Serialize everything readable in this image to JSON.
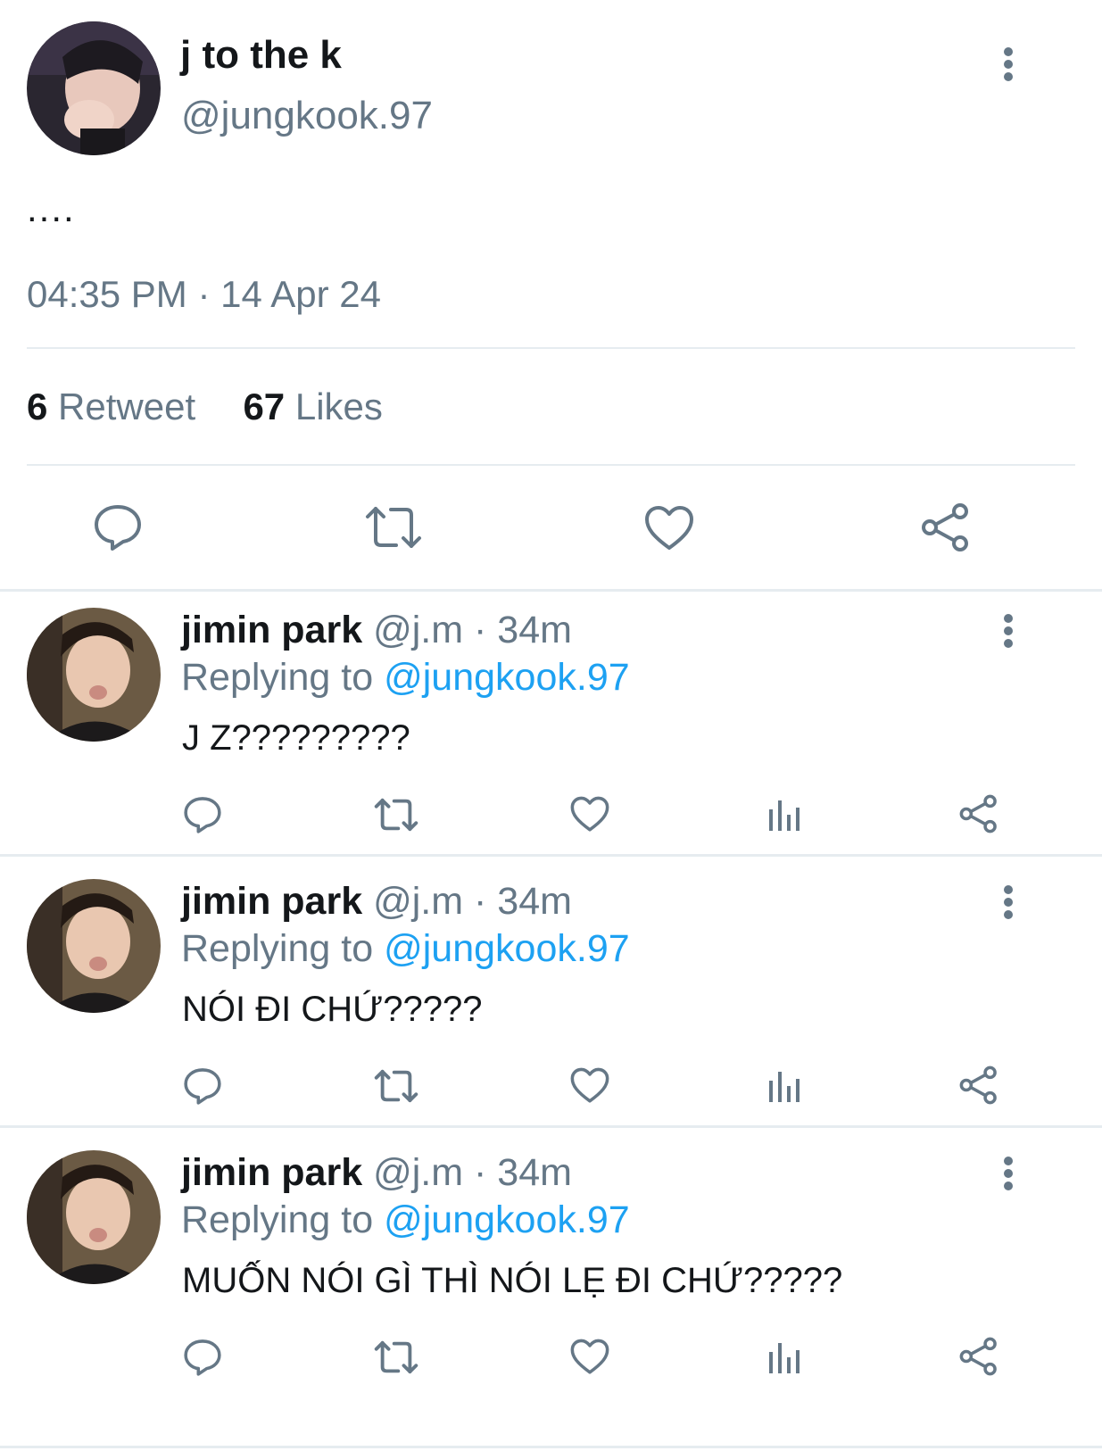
{
  "main_tweet": {
    "display_name": "j to the k",
    "handle": "@jungkook.97",
    "text": "....",
    "time": "04:35 PM",
    "date_sep": "·",
    "date": "14 Apr 24",
    "retweet_count": "6",
    "retweet_label": "Retweet",
    "likes_count": "67",
    "likes_label": "Likes"
  },
  "replies": [
    {
      "display_name": "jimin park",
      "handle": "@j.m",
      "time_sep": "·",
      "time": "34m",
      "replying_label": "Replying to",
      "replying_to": "@jungkook.97",
      "text": "J Z?????????"
    },
    {
      "display_name": "jimin park",
      "handle": "@j.m",
      "time_sep": "·",
      "time": "34m",
      "replying_label": "Replying to",
      "replying_to": "@jungkook.97",
      "text": "NÓI ĐI CHỨ?????"
    },
    {
      "display_name": "jimin park",
      "handle": "@j.m",
      "time_sep": "·",
      "time": "34m",
      "replying_label": "Replying to",
      "replying_to": "@jungkook.97",
      "text": "MUỐN NÓI GÌ THÌ NÓI LẸ ĐI CHỨ?????"
    }
  ],
  "icons": {
    "more": "more-vertical-icon",
    "reply": "comment-icon",
    "retweet": "retweet-icon",
    "like": "heart-icon",
    "stats": "analytics-icon",
    "share": "share-icon"
  },
  "colors": {
    "text": "#14171a",
    "secondary": "#657786",
    "link": "#1da1f2",
    "divider": "#e6ecf0"
  }
}
